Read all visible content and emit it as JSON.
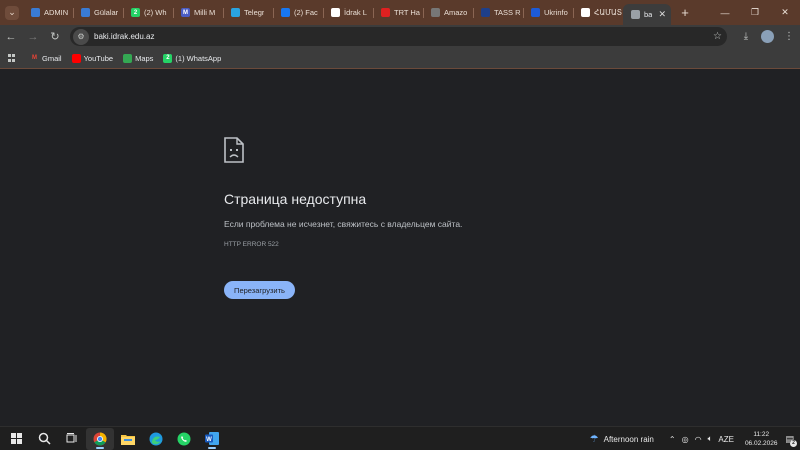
{
  "browser": {
    "tabs": [
      {
        "label": "ADMIN",
        "favicon": "idrak-logo-icon",
        "color": "#3a7bd5"
      },
      {
        "label": "Gülalar",
        "favicon": "idrak-logo-icon",
        "color": "#3a7bd5"
      },
      {
        "label": "(2) Wh",
        "favicon": "whatsapp-icon",
        "color": "#25d366",
        "badge": "2"
      },
      {
        "label": "Milli M",
        "favicon": "milli-icon",
        "color": "#4a5cc4",
        "badge": "M"
      },
      {
        "label": "Telegr",
        "favicon": "telegram-icon",
        "color": "#2aa3e0"
      },
      {
        "label": "(2) Fac",
        "favicon": "facebook-icon",
        "color": "#1877f2"
      },
      {
        "label": "İdrak L",
        "favicon": "idrak-icon",
        "color": "#ffffff"
      },
      {
        "label": "TRT Ha",
        "favicon": "trt-icon",
        "color": "#e02020"
      },
      {
        "label": "Amazo",
        "favicon": "amazon-icon",
        "color": "#777777"
      },
      {
        "label": "TASS R",
        "favicon": "tass-icon",
        "color": "#1e3f8a"
      },
      {
        "label": "Ukrinfo",
        "favicon": "ukrinform-icon",
        "color": "#1d5bd8"
      },
      {
        "label": "ՀԱՄԱՏ",
        "favicon": "armenian-news-icon",
        "color": "#ffffff"
      },
      {
        "label": "ba",
        "favicon": "globe-icon",
        "color": "#9aa0a6",
        "active": true
      }
    ],
    "new_tab_label": "+",
    "url": "baki.idrak.edu.az",
    "bookmarks": [
      {
        "label": "Gmail",
        "icon": "gmail-icon",
        "color": "#ea4335"
      },
      {
        "label": "YouTube",
        "icon": "youtube-icon",
        "color": "#ff0000"
      },
      {
        "label": "Maps",
        "icon": "maps-icon",
        "color": "#34a853"
      },
      {
        "label": "(1) WhatsApp",
        "icon": "whatsapp-icon",
        "color": "#25d366",
        "badge": "2"
      }
    ]
  },
  "error_page": {
    "title": "Страница недоступна",
    "description": "Если проблема не исчезнет, свяжитесь с владельцем сайта.",
    "code": "HTTP ERROR 522",
    "reload_label": "Перезагрузить",
    "button_color": "#8ab4f8"
  },
  "taskbar": {
    "weather": "Afternoon rain",
    "language": "AZE",
    "time": "11:22",
    "date": "06.02.2026",
    "notification_count": "2"
  }
}
